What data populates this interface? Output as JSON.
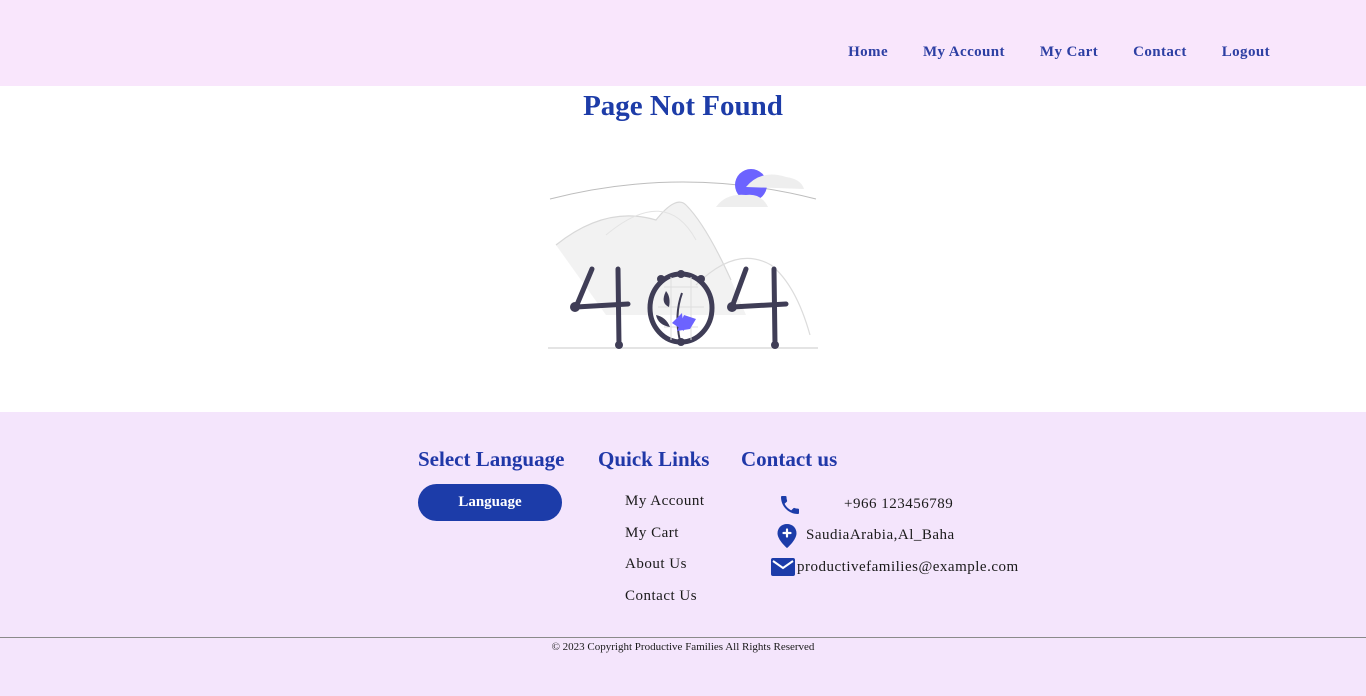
{
  "nav": {
    "items": [
      "Home",
      "My Account",
      "My Cart",
      "Contact",
      "Logout"
    ]
  },
  "page": {
    "title": "Page Not Found"
  },
  "illustration": {
    "icon": "404-illustration",
    "accent": "#6c63ff",
    "dark": "#3f3d56"
  },
  "footer": {
    "language": {
      "title": "Select Language",
      "button_label": "Language"
    },
    "quick_links": {
      "title": "Quick Links",
      "items": [
        "My Account",
        "My Cart",
        "About Us",
        "Contact Us"
      ]
    },
    "contact": {
      "title": "Contact us",
      "phone": "+966 123456789",
      "address": "SaudiaArabia,Al_Baha",
      "email": "productivefamilies@example.com"
    },
    "copyright": "© 2023 Copyright Productive Families All Rights Reserved"
  },
  "colors": {
    "nav_bg": "#f9e6fc",
    "footer_bg": "#f4e5fc",
    "brand": "#1c3ca9"
  }
}
